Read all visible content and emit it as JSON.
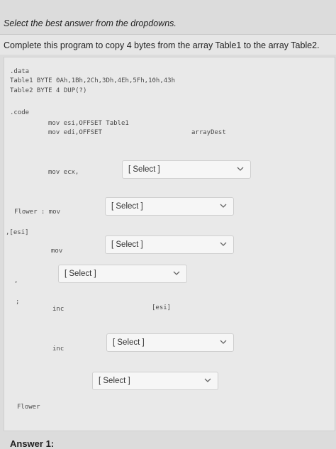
{
  "instructions": "Select the best answer from the dropdowns.",
  "question": "Complete this program to copy 4 bytes from the array Table1 to the array Table2.",
  "code": {
    "data_directive": ".data",
    "table1_line": "Table1 BYTE 0Ah,1Bh,2Ch,3Dh,4Eh,5Fh,10h,43h",
    "table2_line": "Table2 BYTE 4 DUP(?)",
    "code_directive": ".code",
    "mov_esi": "mov esi,OFFSET Table1",
    "mov_edi": "mov edi,OFFSET",
    "array_dest": "arrayDest",
    "mov_ecx": "mov ecx,",
    "flower_mov": "Flower : mov",
    "esi_ref": ",[esi]",
    "mov": "mov",
    "comma": ",",
    "semicolon": ";",
    "inc1": "inc",
    "esi_bracket": "[esi]",
    "inc2": "inc",
    "flower": "Flower"
  },
  "dropdowns": [
    {
      "value": "[ Select ]"
    },
    {
      "value": "[ Select ]"
    },
    {
      "value": "[ Select ]"
    },
    {
      "value": "[ Select ]"
    },
    {
      "value": "[ Select ]"
    },
    {
      "value": "[ Select ]"
    }
  ],
  "answer_label": "Answer 1:",
  "icons": {
    "dropdown": "chevron-down-icon"
  },
  "colors": {
    "background": "#dcdcdc",
    "panel": "#e9e9e9",
    "code_text": "#4a4a4a"
  }
}
